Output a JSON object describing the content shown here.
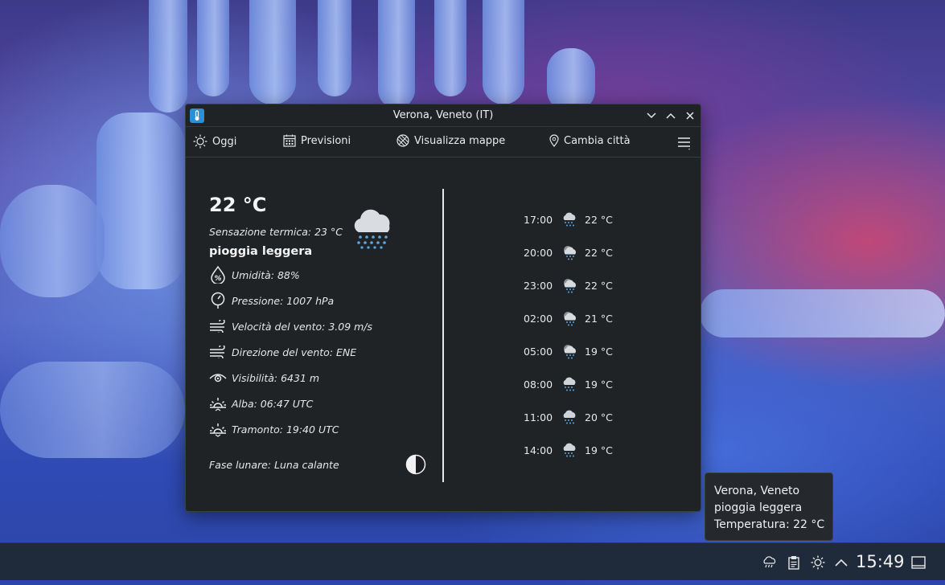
{
  "window": {
    "title": "Verona, Veneto (IT)"
  },
  "toolbar": {
    "today": "Oggi",
    "forecast": "Previsioni",
    "maps": "Visualizza mappe",
    "change_city": "Cambia città"
  },
  "current": {
    "temperature": "22 °C",
    "feels_like": "Sensazione termica: 23 °C",
    "condition": "pioggia leggera",
    "details": [
      {
        "icon": "humidity-icon",
        "text": "Umidità: 88%"
      },
      {
        "icon": "pressure-icon",
        "text": "Pressione: 1007 hPa"
      },
      {
        "icon": "wind-speed-icon",
        "text": "Velocità del vento: 3.09 m/s"
      },
      {
        "icon": "wind-direction-icon",
        "text": "Direzione del vento: ENE"
      },
      {
        "icon": "visibility-icon",
        "text": "Visibilità: 6431 m"
      },
      {
        "icon": "sunrise-icon",
        "text": "Alba: 06:47 UTC"
      },
      {
        "icon": "sunset-icon",
        "text": "Tramonto: 19:40 UTC"
      }
    ],
    "moon_phase": "Fase lunare: Luna calante"
  },
  "hourly": [
    {
      "time": "17:00",
      "icon": "rain-icon",
      "temp": "22 °C"
    },
    {
      "time": "20:00",
      "icon": "rain-sun-icon",
      "temp": "22 °C"
    },
    {
      "time": "23:00",
      "icon": "rain-sun-icon",
      "temp": "22 °C"
    },
    {
      "time": "02:00",
      "icon": "rain-sun-icon",
      "temp": "21 °C"
    },
    {
      "time": "05:00",
      "icon": "rain-sun-icon",
      "temp": "19 °C"
    },
    {
      "time": "08:00",
      "icon": "rain-icon",
      "temp": "19 °C"
    },
    {
      "time": "11:00",
      "icon": "rain-icon",
      "temp": "20 °C"
    },
    {
      "time": "14:00",
      "icon": "rain-icon",
      "temp": "19 °C"
    }
  ],
  "tooltip": {
    "line1": "Verona, Veneto",
    "line2": "pioggia leggera",
    "line3": "Temperatura: 22 °C"
  },
  "taskbar": {
    "clock": "15:49"
  },
  "colors": {
    "window_bg": "#202326",
    "accent": "#2b8fd6",
    "taskbar_bg": "#1f2a3a"
  }
}
